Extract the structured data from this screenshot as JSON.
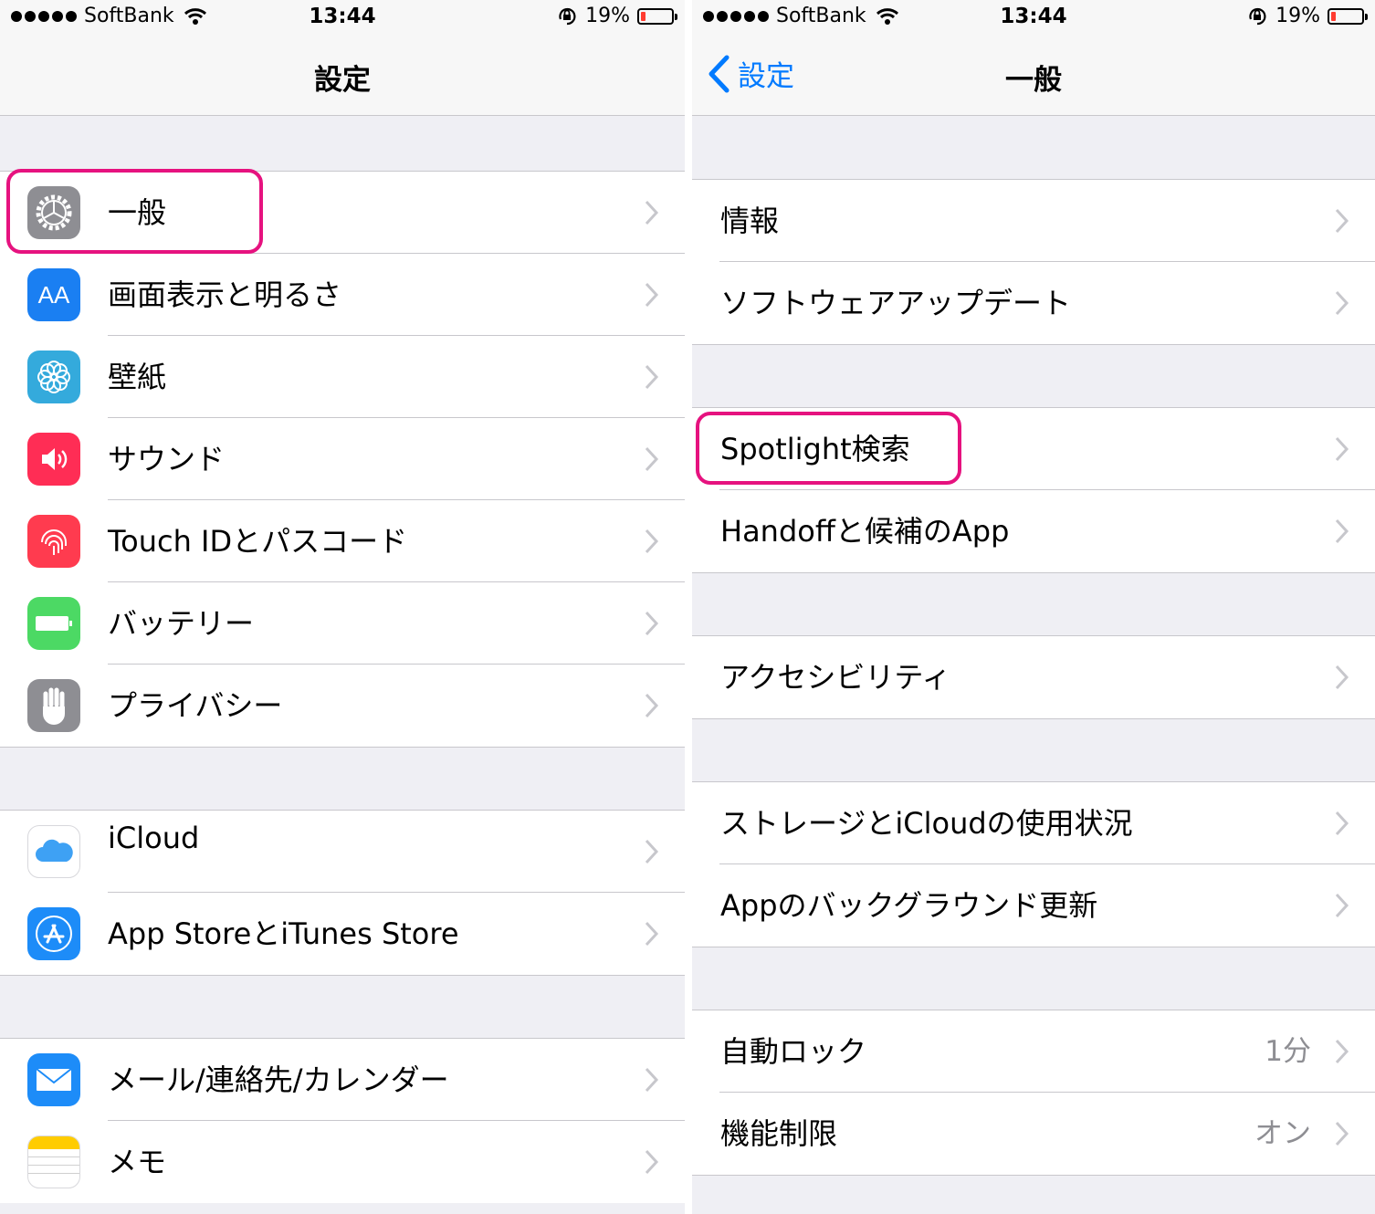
{
  "left": {
    "status": {
      "carrier": "SoftBank",
      "time": "13:44",
      "battery": "19%",
      "battery_level": 0.19
    },
    "title": "設定",
    "group1": [
      {
        "label": "一般",
        "icon": "gear-icon",
        "color": "#8e8e93"
      },
      {
        "label": "画面表示と明るさ",
        "icon": "aa-icon",
        "icon_text": "AA",
        "color": "#1a7ff2"
      },
      {
        "label": "壁紙",
        "icon": "flower-icon",
        "color": "#34aadc"
      },
      {
        "label": "サウンド",
        "icon": "speaker-icon",
        "color": "#ff2d55"
      },
      {
        "label": "Touch IDとパスコード",
        "icon": "fingerprint-icon",
        "color": "#ff3b4f"
      },
      {
        "label": "バッテリー",
        "icon": "battery-icon",
        "color": "#4cd964"
      },
      {
        "label": "プライバシー",
        "icon": "hand-icon",
        "color": "#8e8e93"
      }
    ],
    "group2": [
      {
        "label": "iCloud",
        "icon": "cloud-icon",
        "color": "#ffffff"
      },
      {
        "label": "App StoreとiTunes Store",
        "icon": "appstore-icon",
        "color": "#1d8cf8"
      }
    ],
    "group3": [
      {
        "label": "メール/連絡先/カレンダー",
        "icon": "mail-icon",
        "color": "#1d8cf8"
      },
      {
        "label": "メモ",
        "icon": "notes-icon",
        "color": "#ffffff"
      }
    ]
  },
  "right": {
    "status": {
      "carrier": "SoftBank",
      "time": "13:44",
      "battery": "19%",
      "battery_level": 0.19
    },
    "back_label": "設定",
    "title": "一般",
    "group1": [
      {
        "label": "情報"
      },
      {
        "label": "ソフトウェアアップデート"
      }
    ],
    "group2": [
      {
        "label": "Spotlight検索"
      },
      {
        "label": "Handoffと候補のApp"
      }
    ],
    "group3": [
      {
        "label": "アクセシビリティ"
      }
    ],
    "group4": [
      {
        "label": "ストレージとiCloudの使用状況"
      },
      {
        "label": "Appのバックグラウンド更新"
      }
    ],
    "group5": [
      {
        "label": "自動ロック",
        "value": "1分"
      },
      {
        "label": "機能制限",
        "value": "オン"
      }
    ]
  },
  "colors": {
    "highlight": "#e6127f",
    "tint": "#007aff"
  }
}
